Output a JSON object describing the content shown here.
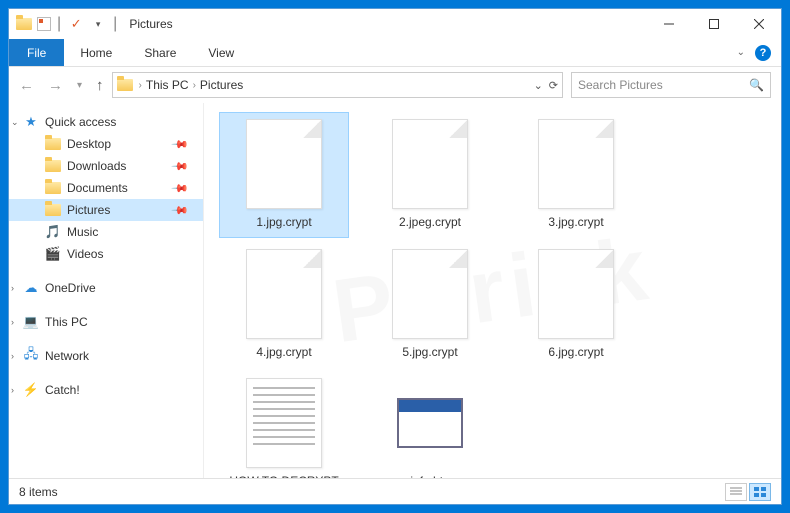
{
  "titlebar": {
    "title": "Pictures"
  },
  "ribbon": {
    "file": "File",
    "tabs": [
      "Home",
      "Share",
      "View"
    ]
  },
  "nav": {
    "crumbs": [
      "This PC",
      "Pictures"
    ]
  },
  "search": {
    "placeholder": "Search Pictures"
  },
  "sidebar": {
    "quick_access": {
      "label": "Quick access",
      "items": [
        {
          "label": "Desktop",
          "pinned": true,
          "icon": "desktop"
        },
        {
          "label": "Downloads",
          "pinned": true,
          "icon": "downloads"
        },
        {
          "label": "Documents",
          "pinned": true,
          "icon": "documents"
        },
        {
          "label": "Pictures",
          "pinned": true,
          "icon": "pictures",
          "selected": true
        },
        {
          "label": "Music",
          "pinned": false,
          "icon": "music"
        },
        {
          "label": "Videos",
          "pinned": false,
          "icon": "videos"
        }
      ]
    },
    "roots": [
      {
        "label": "OneDrive",
        "icon": "onedrive"
      },
      {
        "label": "This PC",
        "icon": "thispc"
      },
      {
        "label": "Network",
        "icon": "network"
      },
      {
        "label": "Catch!",
        "icon": "catch"
      }
    ]
  },
  "files": [
    {
      "name": "1.jpg.crypt",
      "type": "blank",
      "selected": true
    },
    {
      "name": "2.jpeg.crypt",
      "type": "blank"
    },
    {
      "name": "3.jpg.crypt",
      "type": "blank"
    },
    {
      "name": "4.jpg.crypt",
      "type": "blank"
    },
    {
      "name": "5.jpg.crypt",
      "type": "blank"
    },
    {
      "name": "6.jpg.crypt",
      "type": "blank"
    },
    {
      "name": "HOW TO DECRYPT FILES.txt",
      "type": "text"
    },
    {
      "name": "info.hta",
      "type": "hta"
    }
  ],
  "status": {
    "count_label": "8 items"
  }
}
